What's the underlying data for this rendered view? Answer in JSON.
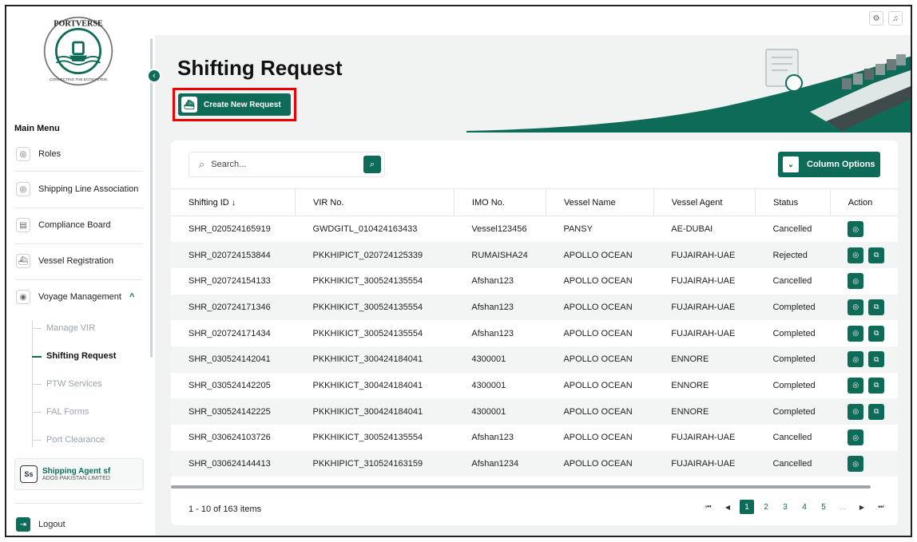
{
  "brand": {
    "logo_text": "PORTVERSE",
    "logo_tagline": "CONNECTING THE ECOSYSTEM",
    "accent": "#0e6b57"
  },
  "sidebar": {
    "main_menu_label": "Main Menu",
    "items": [
      {
        "label": "Roles",
        "icon": "roles-icon"
      },
      {
        "label": "Shipping Line Association",
        "icon": "association-icon"
      },
      {
        "label": "Compliance Board",
        "icon": "document-icon"
      },
      {
        "label": "Vessel Registration",
        "icon": "ship-icon"
      },
      {
        "label": "Voyage Management",
        "icon": "location-icon",
        "chevron": "^"
      }
    ],
    "subitems": [
      {
        "label": "Manage VIR"
      },
      {
        "label": "Shifting Request",
        "active": true
      },
      {
        "label": "PTW Services"
      },
      {
        "label": "FAL Forms"
      },
      {
        "label": "Port Clearance"
      }
    ],
    "user": {
      "initials": "Ss",
      "name": "Shipping Agent sf",
      "org": "ADOS PAKISTAN LIMITED"
    },
    "logout_label": "Logout"
  },
  "page": {
    "title": "Shifting Request",
    "create_button": "Create New Request"
  },
  "search": {
    "placeholder": "Search..."
  },
  "column_options_label": "Column Options",
  "table": {
    "headers": [
      "Shifting ID ↓",
      "VIR No.",
      "IMO No.",
      "Vessel Name",
      "Vessel Agent",
      "Status",
      "Action"
    ],
    "rows": [
      {
        "id": "SHR_020524165919",
        "vir": "GWDGITL_010424163433",
        "imo": "Vessel123456",
        "vessel": "PANSY",
        "agent": "AE-DUBAI",
        "status": "Cancelled"
      },
      {
        "id": "SHR_020724153844",
        "vir": "PKKHIPICT_020724125339",
        "imo": "RUMAISHA24",
        "vessel": "APOLLO OCEAN",
        "agent": "FUJAIRAH-UAE",
        "status": "Rejected"
      },
      {
        "id": "SHR_020724154133",
        "vir": "PKKHIKICT_300524135554",
        "imo": "Afshan123",
        "vessel": "APOLLO OCEAN",
        "agent": "FUJAIRAH-UAE",
        "status": "Cancelled"
      },
      {
        "id": "SHR_020724171346",
        "vir": "PKKHIKICT_300524135554",
        "imo": "Afshan123",
        "vessel": "APOLLO OCEAN",
        "agent": "FUJAIRAH-UAE",
        "status": "Completed"
      },
      {
        "id": "SHR_020724171434",
        "vir": "PKKHIKICT_300524135554",
        "imo": "Afshan123",
        "vessel": "APOLLO OCEAN",
        "agent": "FUJAIRAH-UAE",
        "status": "Completed"
      },
      {
        "id": "SHR_030524142041",
        "vir": "PKKHIKICT_300424184041",
        "imo": "4300001",
        "vessel": "APOLLO OCEAN",
        "agent": "ENNORE",
        "status": "Completed"
      },
      {
        "id": "SHR_030524142205",
        "vir": "PKKHIKICT_300424184041",
        "imo": "4300001",
        "vessel": "APOLLO OCEAN",
        "agent": "ENNORE",
        "status": "Completed"
      },
      {
        "id": "SHR_030524142225",
        "vir": "PKKHIKICT_300424184041",
        "imo": "4300001",
        "vessel": "APOLLO OCEAN",
        "agent": "ENNORE",
        "status": "Completed"
      },
      {
        "id": "SHR_030624103726",
        "vir": "PKKHIKICT_300524135554",
        "imo": "Afshan123",
        "vessel": "APOLLO OCEAN",
        "agent": "FUJAIRAH-UAE",
        "status": "Cancelled"
      },
      {
        "id": "SHR_030624144413",
        "vir": "PKKHIPICT_310524163159",
        "imo": "Afshan1234",
        "vessel": "APOLLO OCEAN",
        "agent": "FUJAIRAH-UAE",
        "status": "Cancelled"
      }
    ]
  },
  "footer": {
    "items_text": "1 - 10 of 163 items",
    "pages": [
      "1",
      "2",
      "3",
      "4",
      "5",
      "..."
    ],
    "current_page": "1"
  }
}
